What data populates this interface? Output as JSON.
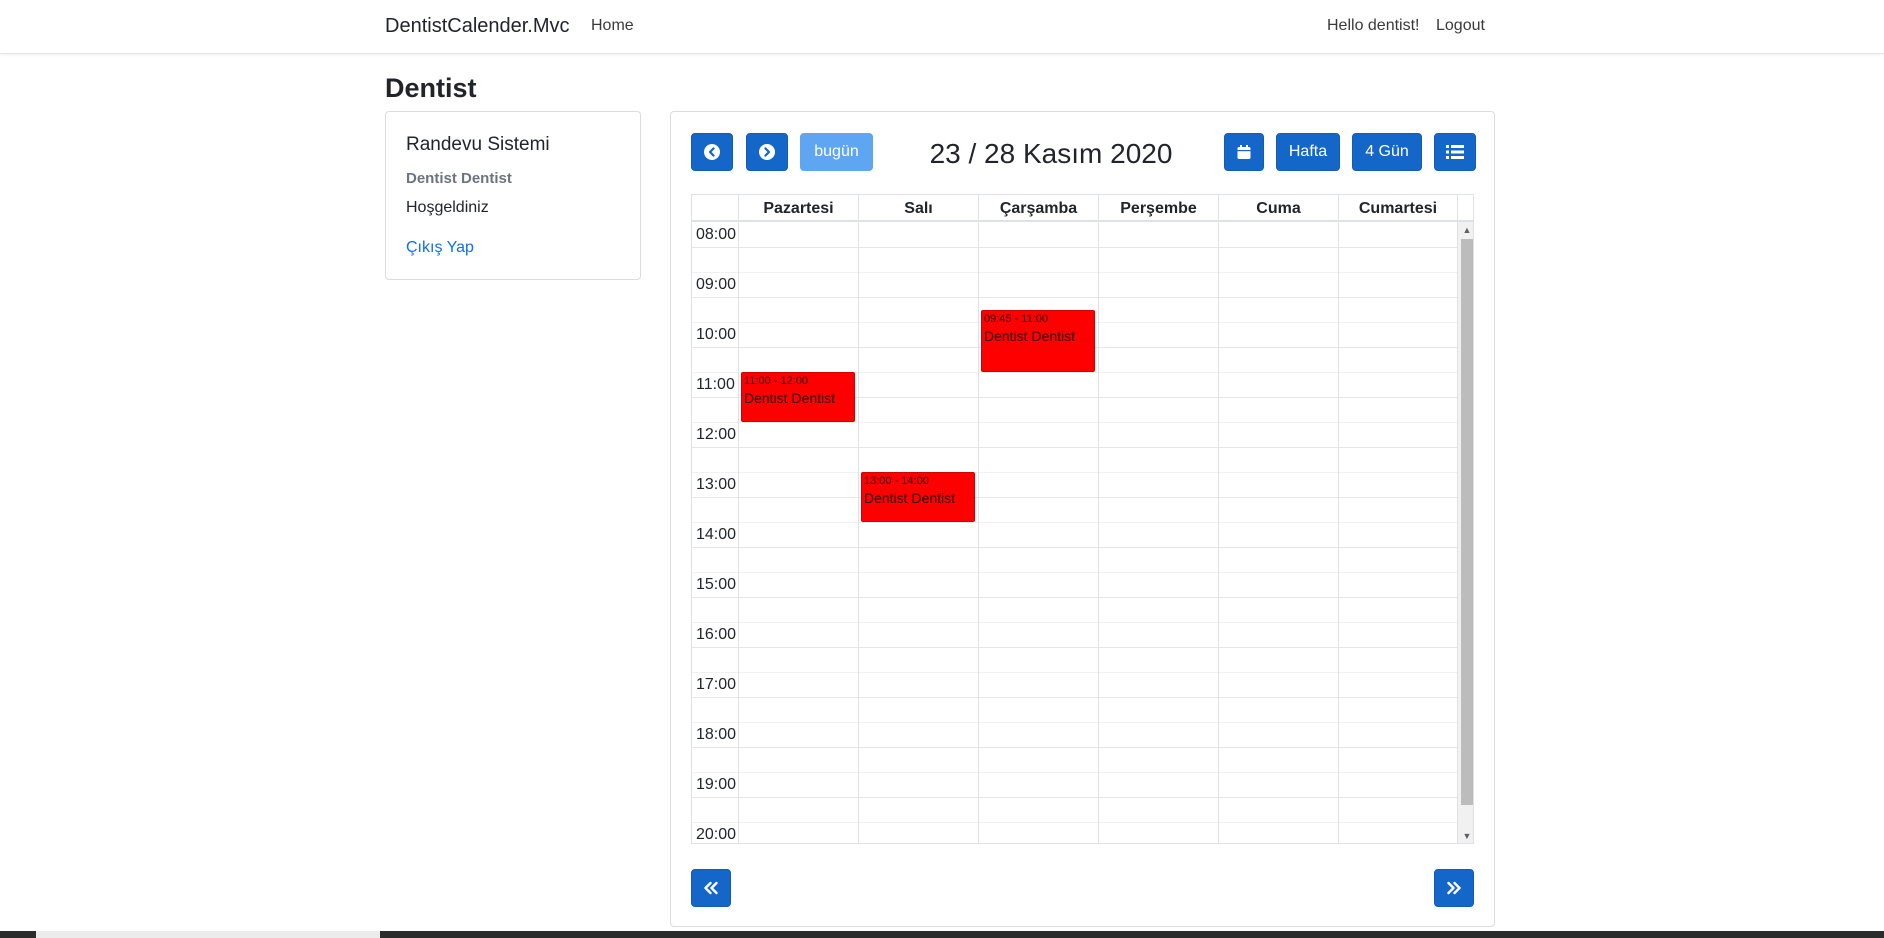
{
  "navbar": {
    "brand": "DentistCalender.Mvc",
    "home": "Home",
    "hello": "Hello dentist!",
    "logout": "Logout"
  },
  "page": {
    "title": "Dentist"
  },
  "sidebar": {
    "title": "Randevu Sistemi",
    "user": "Dentist Dentist",
    "welcome": "Hoşgeldiniz",
    "exit": "Çıkış Yap"
  },
  "calendar": {
    "title": "23 / 28 Kasım 2020",
    "today_label": "bugün",
    "week_label": "Hafta",
    "four_day_label": "4 Gün",
    "days": [
      "Pazartesi",
      "Salı",
      "Çarşamba",
      "Perşembe",
      "Cuma",
      "Cumartesi"
    ],
    "times": [
      "08:00",
      "09:00",
      "10:00",
      "11:00",
      "12:00",
      "13:00",
      "14:00",
      "15:00",
      "16:00",
      "17:00",
      "18:00",
      "19:00",
      "20:00"
    ],
    "event_color": "#ff0000",
    "accent_color": "#1467c9",
    "events": [
      {
        "day": 0,
        "time": "11:00 - 12:00",
        "title": "Dentist Dentist"
      },
      {
        "day": 1,
        "time": "13:00 - 14:00",
        "title": "Dentist Dentist"
      },
      {
        "day": 2,
        "time": "09:45 - 11:00",
        "title": "Dentist Dentist"
      }
    ]
  },
  "icons": {
    "prev": "chevron-left-circle-icon",
    "next": "chevron-right-circle-icon",
    "month": "calendar-icon",
    "list": "list-icon",
    "prev_fast": "double-chevron-left-icon",
    "next_fast": "double-chevron-right-icon"
  }
}
